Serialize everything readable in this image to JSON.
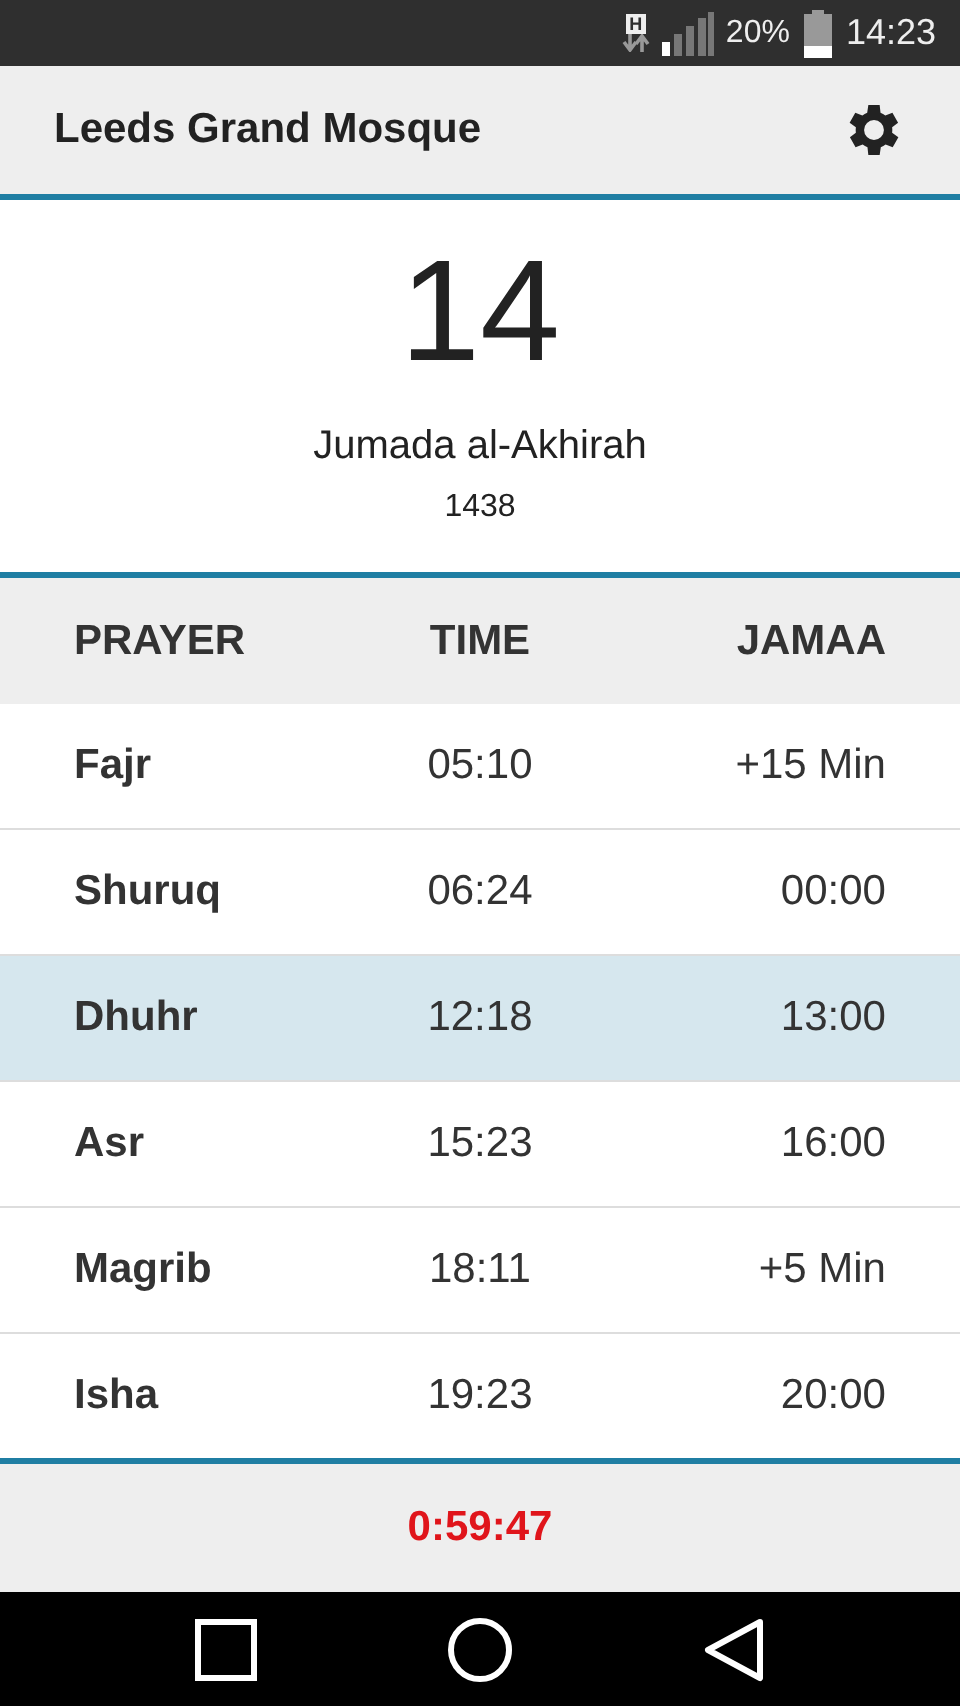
{
  "status_bar": {
    "network": "H",
    "battery_percent": "20%",
    "time": "14:23"
  },
  "header": {
    "title": "Leeds Grand Mosque"
  },
  "date": {
    "day": "14",
    "month": "Jumada al-Akhirah",
    "year": "1438"
  },
  "table": {
    "columns": [
      "PRAYER",
      "TIME",
      "JAMAA"
    ],
    "rows": [
      {
        "prayer": "Fajr",
        "time": "05:10",
        "jamaa": "+15 Min",
        "selected": false
      },
      {
        "prayer": "Shuruq",
        "time": "06:24",
        "jamaa": "00:00",
        "selected": false
      },
      {
        "prayer": "Dhuhr",
        "time": "12:18",
        "jamaa": "13:00",
        "selected": true
      },
      {
        "prayer": "Asr",
        "time": "15:23",
        "jamaa": "16:00",
        "selected": false
      },
      {
        "prayer": "Magrib",
        "time": "18:11",
        "jamaa": "+5 Min",
        "selected": false
      },
      {
        "prayer": "Isha",
        "time": "19:23",
        "jamaa": "20:00",
        "selected": false
      }
    ]
  },
  "countdown": "0:59:47"
}
